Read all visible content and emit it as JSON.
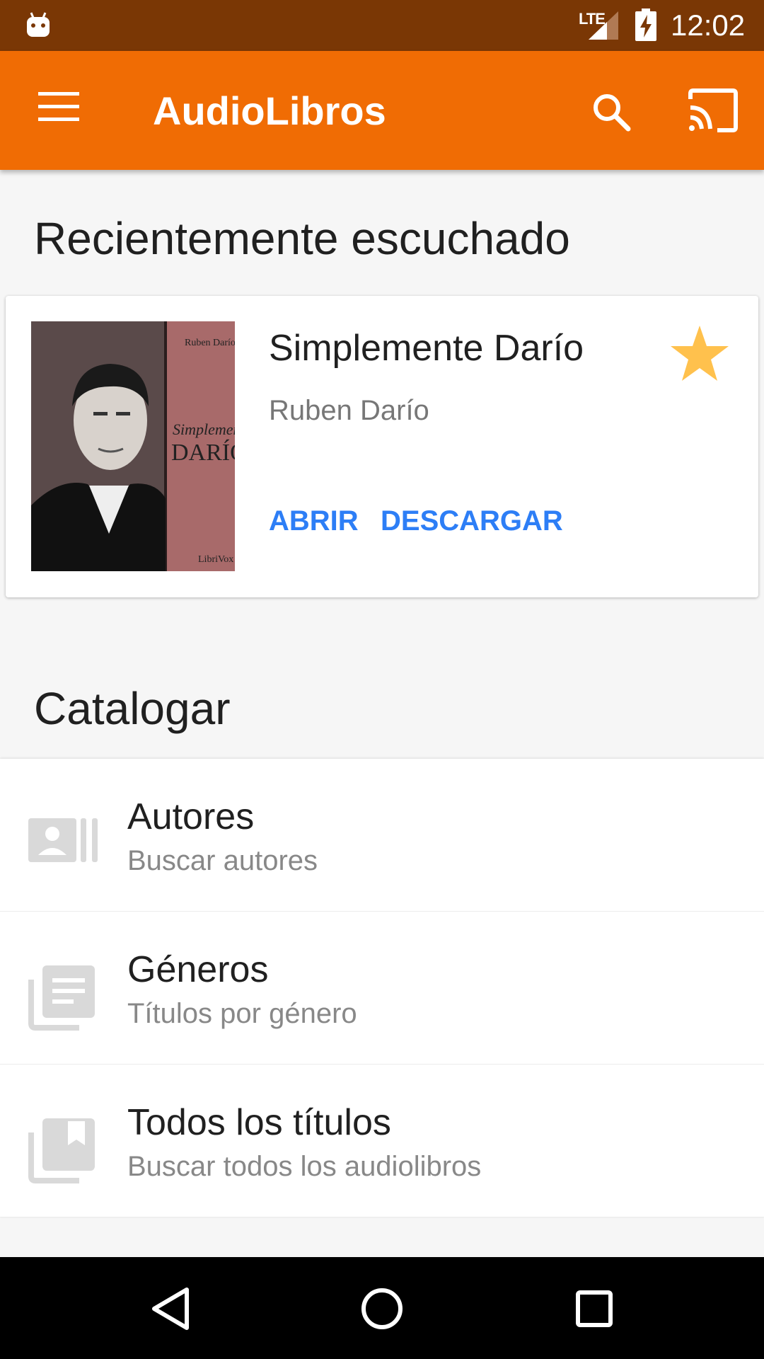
{
  "status_bar": {
    "time": "12:02",
    "network": "LTE"
  },
  "app_bar": {
    "title": "AudioLibros"
  },
  "recent": {
    "heading": "Recientemente escuchado",
    "book": {
      "title": "Simplemente Darío",
      "author": "Ruben Darío",
      "cover_author": "Ruben Darío",
      "cover_title_top": "Simplemente",
      "cover_title_bottom": "DARÍO",
      "cover_publisher": "LibriVox"
    },
    "actions": {
      "open_label": "ABRIR",
      "download_label": "DESCARGAR"
    }
  },
  "catalog": {
    "heading": "Catalogar",
    "items": [
      {
        "title": "Autores",
        "subtitle": "Buscar autores",
        "icon": "contacts-icon"
      },
      {
        "title": "Géneros",
        "subtitle": "Títulos por género",
        "icon": "library-books-icon"
      },
      {
        "title": "Todos los títulos",
        "subtitle": "Buscar todos los audiolibros",
        "icon": "collections-bookmark-icon"
      }
    ]
  },
  "colors": {
    "status_bar": "#7a3705",
    "app_bar": "#f06c04",
    "accent_button": "#2d7ef6",
    "star": "#ffc14d"
  }
}
